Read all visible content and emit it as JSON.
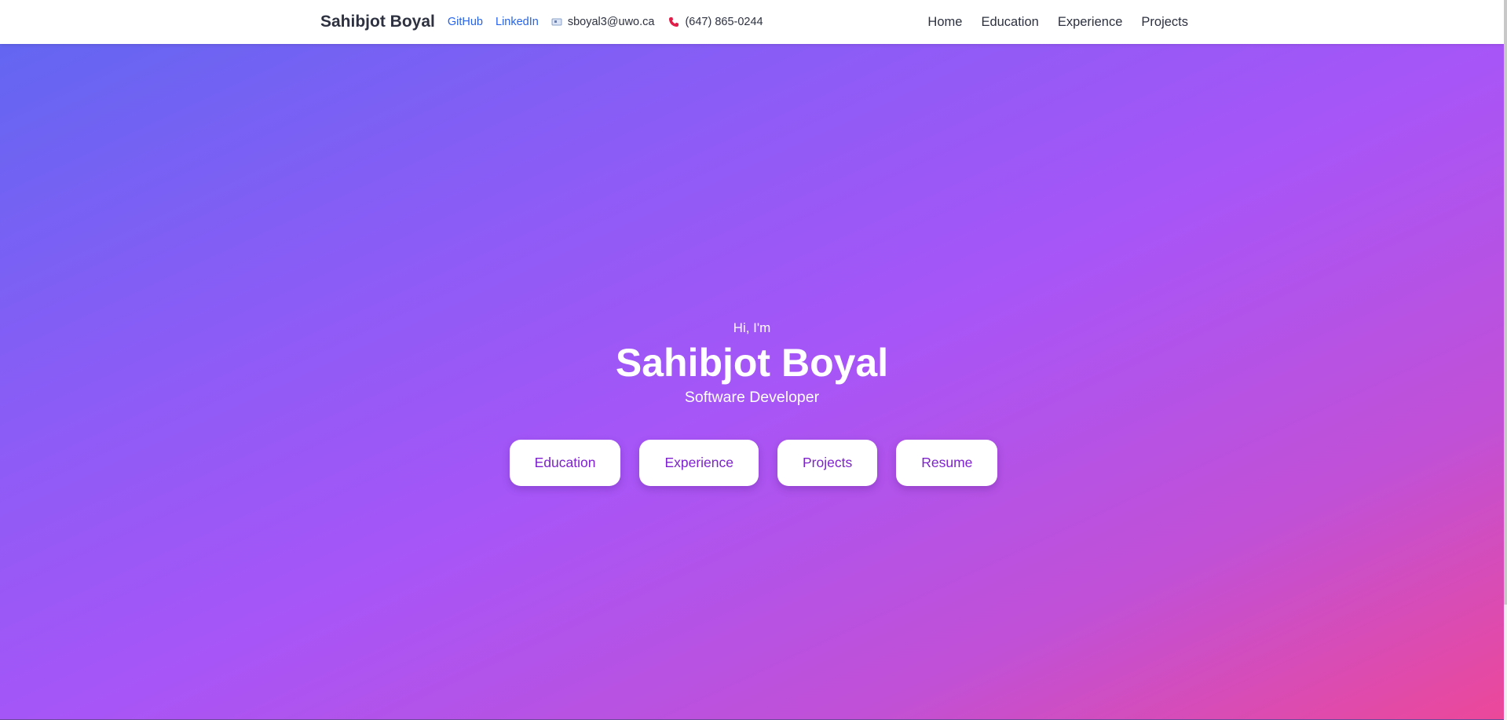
{
  "navbar": {
    "brand": "Sahibjot Boyal",
    "github_label": "GitHub",
    "linkedin_label": "LinkedIn",
    "email": "sboyal3@uwo.ca",
    "phone": "(647) 865-0244",
    "menu": [
      {
        "label": "Home"
      },
      {
        "label": "Education"
      },
      {
        "label": "Experience"
      },
      {
        "label": "Projects"
      }
    ]
  },
  "hero": {
    "greeting": "Hi, I'm",
    "name": "Sahibjot Boyal",
    "role": "Software Developer",
    "buttons": [
      {
        "label": "Education"
      },
      {
        "label": "Experience"
      },
      {
        "label": "Projects"
      },
      {
        "label": "Resume"
      }
    ]
  },
  "colors": {
    "link": "#2563eb",
    "button_text": "#7e22ce",
    "gradient_start": "#6366f1",
    "gradient_mid": "#a855f7",
    "gradient_end": "#ec4899",
    "phone_icon": "#e11d48"
  },
  "icons": {
    "email": "email-icon",
    "phone": "phone-icon"
  }
}
